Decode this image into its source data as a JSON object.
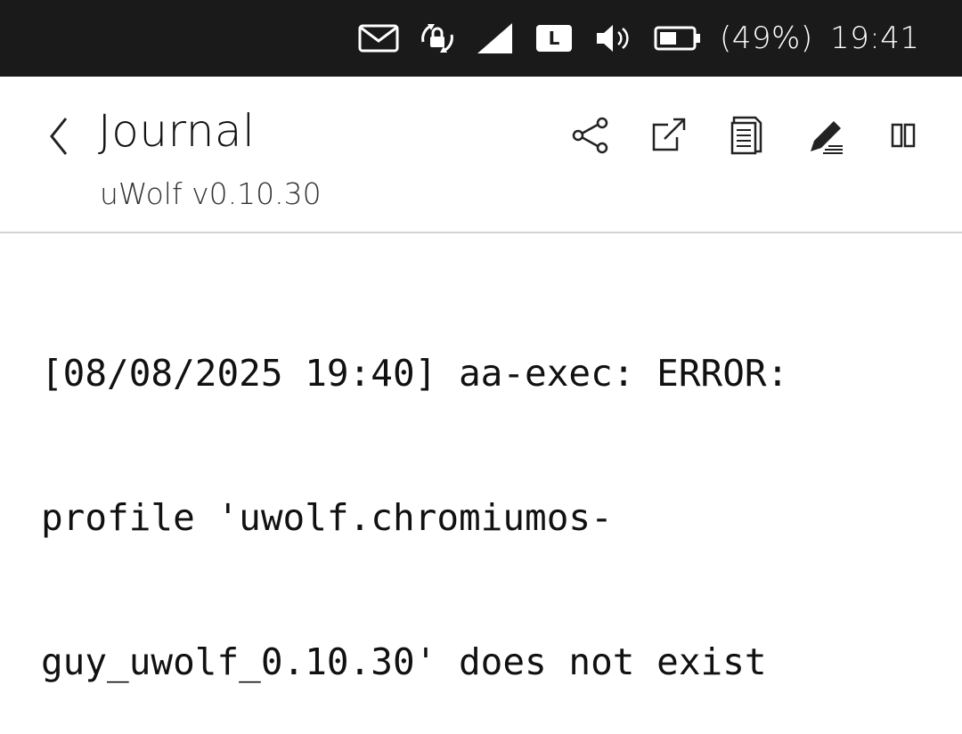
{
  "status_bar": {
    "icons": [
      "mail-icon",
      "rotation-lock-icon",
      "cellular-signal-icon",
      "keyboard-layout-icon",
      "volume-icon",
      "battery-icon"
    ],
    "keyboard_layout": "L",
    "battery": "(49%)",
    "time": "19:41"
  },
  "header": {
    "back_icon": "chevron-left-icon",
    "title": "Journal",
    "subtitle": "uWolf v0.10.30",
    "actions": [
      "share-icon",
      "open-external-icon",
      "copy-icon",
      "edit-icon",
      "split-view-icon"
    ]
  },
  "log": {
    "lines": [
      "[08/08/2025 19:40] aa-exec: ERROR:",
      "profile 'uwolf.chromiumos-",
      "guy_uwolf_0.10.30' does not exist"
    ]
  },
  "colors": {
    "status_bar_bg": "#1a1a1a",
    "header_bg": "#ffffff",
    "divider": "#d3d3d3",
    "text": "#111111"
  }
}
